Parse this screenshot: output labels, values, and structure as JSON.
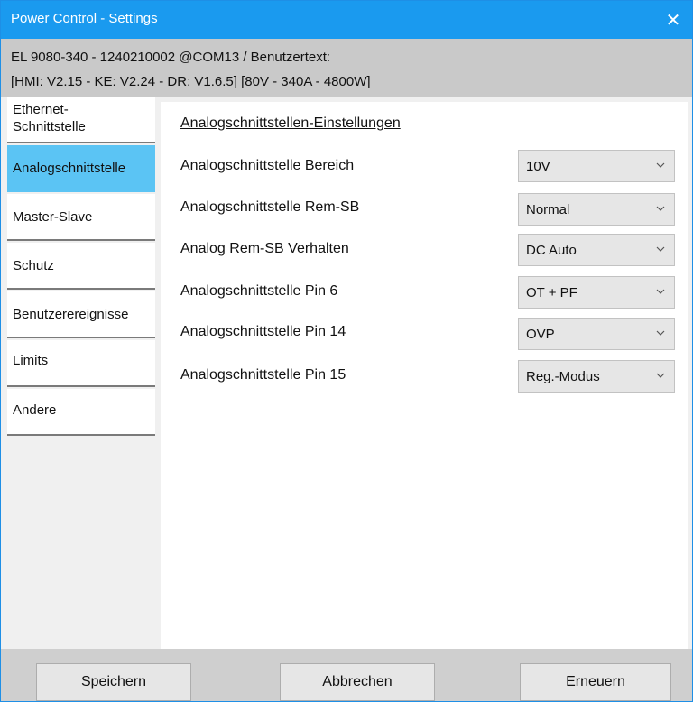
{
  "window": {
    "title": "Power Control - Settings",
    "close_glyph": "✕",
    "accent_color": "#1a9aef"
  },
  "device_info": {
    "line1": "EL 9080-340 - 1240210002 @COM13 / Benutzertext:",
    "line2": "[HMI: V2.15 - KE: V2.24 - DR: V1.6.5] [80V - 340A - 4800W]"
  },
  "sidebar": {
    "active_color": "#5bc4f4",
    "items": [
      {
        "label": "Ethernet-\nSchnittstelle",
        "active": false
      },
      {
        "label": "Analogschnittstelle",
        "active": true
      },
      {
        "label": "Master-Slave",
        "active": false
      },
      {
        "label": "Schutz",
        "active": false
      },
      {
        "label": "Benutzerereignisse",
        "active": false
      },
      {
        "label": "Limits",
        "active": false
      },
      {
        "label": "Andere",
        "active": false
      }
    ]
  },
  "panel": {
    "heading": "Analogschnittstellen-Einstellungen",
    "settings": [
      {
        "label": "Analogschnittstelle Bereich",
        "value": "10V"
      },
      {
        "label": "Analogschnittstelle Rem-SB",
        "value": "Normal"
      },
      {
        "label": "Analog Rem-SB Verhalten",
        "value": "DC Auto"
      },
      {
        "label": "Analogschnittstelle Pin 6",
        "value": "OT + PF"
      },
      {
        "label": "Analogschnittstelle Pin 14",
        "value": "OVP"
      },
      {
        "label": "Analogschnittstelle Pin 15",
        "value": "Reg.-Modus"
      }
    ]
  },
  "footer": {
    "save_label": "Speichern",
    "cancel_label": "Abbrechen",
    "refresh_label": "Erneuern"
  }
}
